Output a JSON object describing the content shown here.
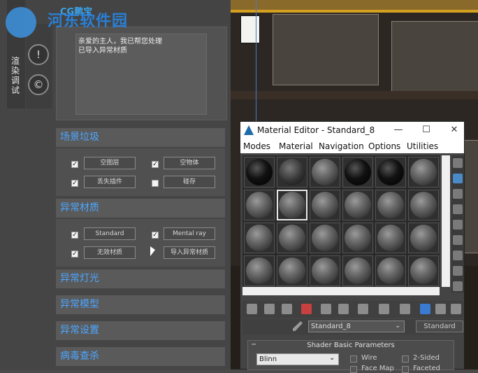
{
  "watermark": {
    "text": "河东软件园",
    "brand": "CG鹏宝"
  },
  "plugin": {
    "vertical_tab": "渲染调试",
    "log_lines": [
      "亲爱的主人，我已帮您处理",
      "已导入异常材质"
    ],
    "sections": [
      {
        "title": "场景垃圾",
        "rows": [
          [
            {
              "label": "空图层",
              "checked": true
            },
            {
              "label": "空物体",
              "checked": true
            }
          ],
          [
            {
              "label": "丢失插件",
              "checked": true
            },
            {
              "label": "碰存",
              "checked": false
            }
          ]
        ]
      },
      {
        "title": "异常材质",
        "rows": [
          [
            {
              "label": "Standard",
              "checked": true
            },
            {
              "label": "Mental ray",
              "checked": true
            }
          ],
          [
            {
              "label": "无效材质",
              "checked": true
            },
            {
              "label": "导入异常材质",
              "checked": false
            }
          ]
        ]
      },
      {
        "title": "异常灯光"
      },
      {
        "title": "异常模型"
      },
      {
        "title": "异常设置"
      },
      {
        "title": "病毒查杀"
      }
    ]
  },
  "material_editor": {
    "title": "Material Editor - Standard_8",
    "menu": [
      "Modes",
      "Material",
      "Navigation",
      "Options",
      "Utilities"
    ],
    "material_name": "Standard_8",
    "material_type": "Standard",
    "rollout_title": "Shader Basic Parameters",
    "shader": "Blinn",
    "options": [
      "Wire",
      "2-Sided",
      "Face Map",
      "Faceted"
    ]
  }
}
